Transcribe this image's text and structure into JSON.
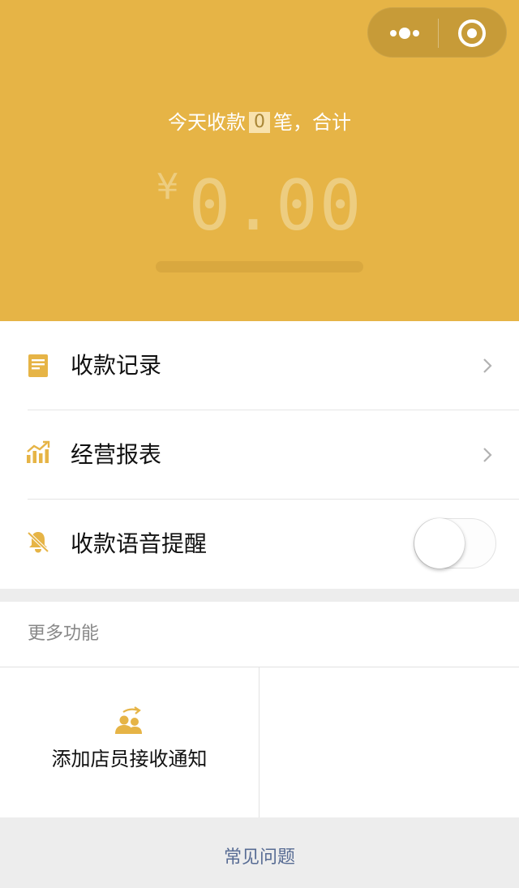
{
  "capsule": {
    "more_icon": "more-dots-icon",
    "close_icon": "target-close-icon"
  },
  "summary": {
    "prefix": "今天收款",
    "count": "0",
    "suffix": "笔，合计",
    "currency": "¥",
    "amount": "0.00",
    "progress": 0.0
  },
  "menu": {
    "records_label": "收款记录",
    "records_icon": "document-icon",
    "report_label": "经营报表",
    "report_icon": "bar-chart-icon",
    "voice_label": "收款语音提醒",
    "voice_icon": "bell-muted-icon",
    "voice_enabled": false
  },
  "more": {
    "title": "更多功能",
    "items": [
      {
        "label": "添加店员接收通知",
        "icon": "add-staff-icon"
      }
    ]
  },
  "faq": {
    "label": "常见问题"
  },
  "colors": {
    "accent": "#e6b446",
    "link": "#586c94"
  }
}
